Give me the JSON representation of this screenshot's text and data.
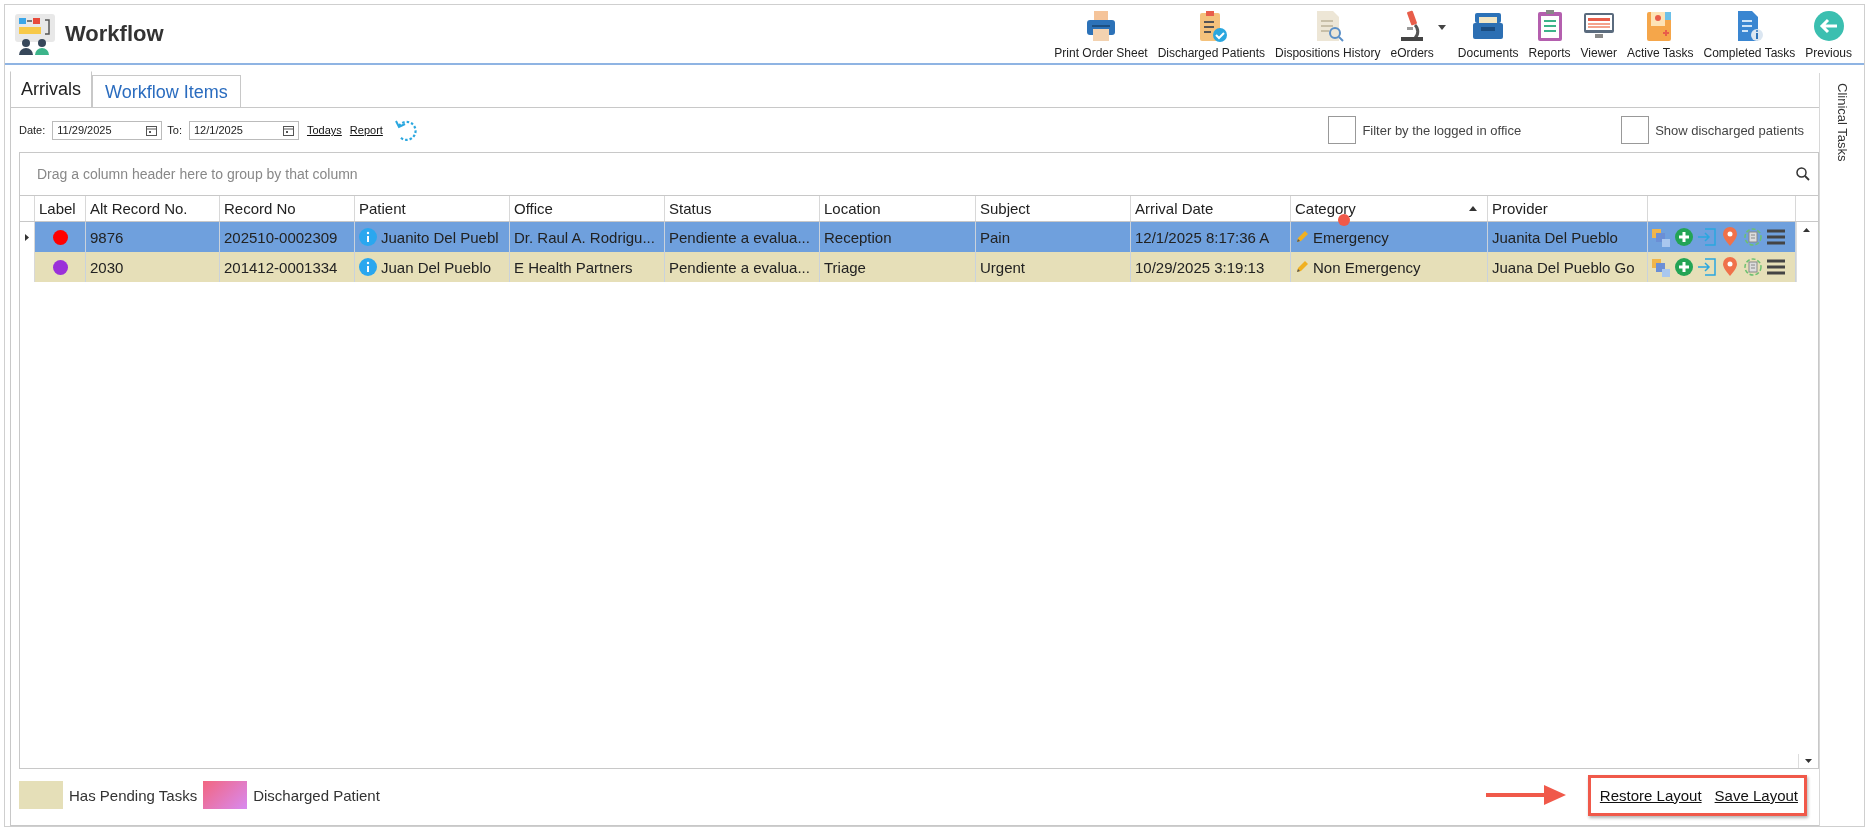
{
  "window": {
    "title": "Workflow"
  },
  "toolbar": [
    {
      "label": "Print Order Sheet",
      "has_menu": false
    },
    {
      "label": "Discharged Patients",
      "has_menu": false
    },
    {
      "label": "Dispositions History",
      "has_menu": false
    },
    {
      "label": "eOrders",
      "has_menu": true
    },
    {
      "label": "Documents",
      "has_menu": false
    },
    {
      "label": "Reports",
      "has_menu": false
    },
    {
      "label": "Viewer",
      "has_menu": false
    },
    {
      "label": "Active Tasks",
      "has_menu": false
    },
    {
      "label": "Completed Tasks",
      "has_menu": false
    },
    {
      "label": "Previous",
      "has_menu": false
    }
  ],
  "tabs": [
    {
      "label": "Arrivals",
      "selected": true
    },
    {
      "label": "Workflow Items",
      "selected": false
    }
  ],
  "side_panel": {
    "label": "Clinical Tasks"
  },
  "filters": {
    "date_label": "Date:",
    "date_from": "11/29/2025",
    "to_label": "To:",
    "date_to": "12/1/2025",
    "links": [
      "Todays",
      "Report"
    ],
    "checkboxes": [
      {
        "label": "Filter by the logged in office",
        "checked": false
      },
      {
        "label": "Show discharged patients",
        "checked": false
      }
    ]
  },
  "group_panel": {
    "placeholder": "Drag a column header here to group by that column"
  },
  "table": {
    "columns": [
      {
        "label": "Label",
        "sorted": false,
        "marked": false
      },
      {
        "label": "Alt Record No.",
        "sorted": false,
        "marked": false
      },
      {
        "label": "Record No",
        "sorted": false,
        "marked": false
      },
      {
        "label": "Patient",
        "sorted": false,
        "marked": false
      },
      {
        "label": "Office",
        "sorted": false,
        "marked": false
      },
      {
        "label": "Status",
        "sorted": false,
        "marked": false
      },
      {
        "label": "Location",
        "sorted": false,
        "marked": false
      },
      {
        "label": "Subject",
        "sorted": false,
        "marked": false
      },
      {
        "label": "Arrival Date",
        "sorted": false,
        "marked": false
      },
      {
        "label": "Category",
        "sorted": true,
        "marked": true
      },
      {
        "label": "Provider",
        "sorted": false,
        "marked": false
      }
    ],
    "rows": [
      {
        "selected": true,
        "pending_tasks": false,
        "color": "#ff0000",
        "cells": [
          "",
          "9876",
          "202510-0002309",
          "Juanito Del Puebl",
          "Dr. Raul A. Rodrigu...",
          "Pendiente a evalua...",
          "Reception",
          "Pain",
          "12/1/2025 8:17:36 A",
          "Emergency",
          "Juanita Del Pueblo"
        ]
      },
      {
        "selected": false,
        "pending_tasks": true,
        "color": "#9b30d9",
        "cells": [
          "",
          "2030",
          "201412-0001334",
          "Juan Del Pueblo",
          "E Health Partners",
          "Pendiente a evalua...",
          "Triage",
          "Urgent",
          "10/29/2025 3:19:13",
          "Non Emergency",
          "Juana Del Pueblo Go"
        ]
      }
    ]
  },
  "legend": [
    {
      "label": "Has Pending Tasks",
      "kind": "solid"
    },
    {
      "label": "Discharged Patient",
      "kind": "gradient"
    }
  ],
  "layout_links": {
    "highlighted": true,
    "items": [
      "Restore Layout",
      "Save Layout"
    ]
  }
}
